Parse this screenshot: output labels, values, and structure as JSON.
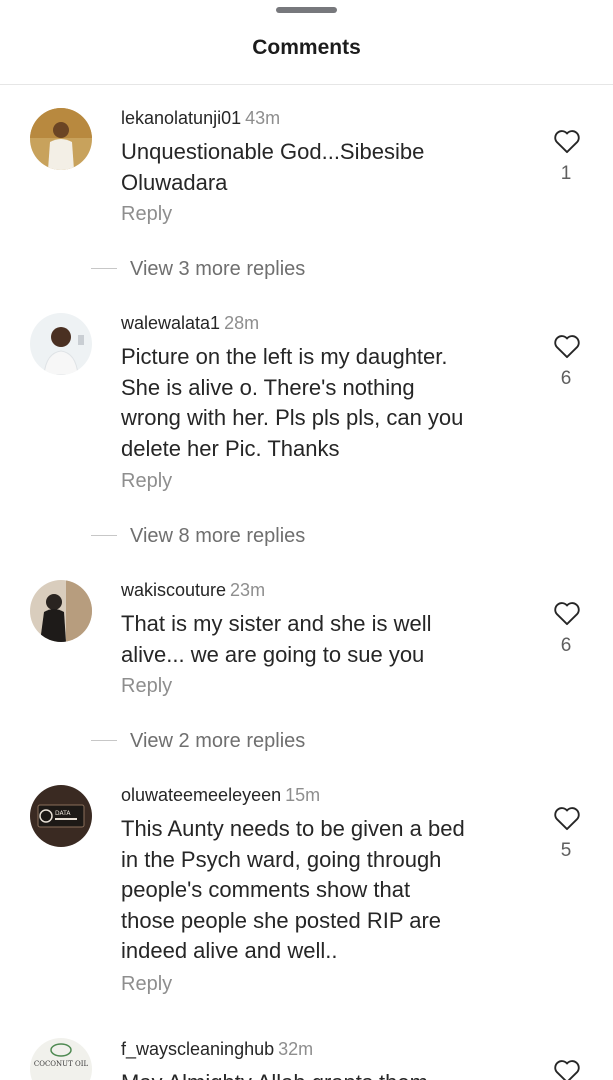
{
  "header": {
    "title": "Comments"
  },
  "comments": [
    {
      "username": "lekanolatunji01",
      "time": "43m",
      "lines": [
        "Unquestionable God...Sibesibe",
        "Oluwadara"
      ],
      "reply_label": "Reply",
      "likes": "1",
      "more_replies": "View 3 more replies"
    },
    {
      "username": "walewalata1",
      "time": "28m",
      "lines": [
        "Picture on the left is my daughter.",
        "She is alive o. There's nothing",
        "wrong with her. Pls pls pls, can you",
        "delete her Pic. Thanks"
      ],
      "reply_label": "Reply",
      "likes": "6",
      "more_replies": "View 8 more replies"
    },
    {
      "username": "wakiscouture",
      "time": "23m",
      "lines": [
        "That is my sister and she is well",
        "alive... we are going to sue you"
      ],
      "reply_label": "Reply",
      "likes": "6",
      "more_replies": "View 2 more replies"
    },
    {
      "username": "oluwateemeeleyeen",
      "time": "15m",
      "lines": [
        "This Aunty needs to be given a bed",
        "in the Psych ward, going through",
        "people's comments show that",
        "those people she posted RIP are",
        "indeed alive and well.."
      ],
      "reply_label": "Reply",
      "likes": "5"
    },
    {
      "username": "f_wayscleaninghub",
      "time": "32m",
      "lines": [
        "May Almighty Allah grants them"
      ]
    }
  ],
  "avatar_badges": {
    "d": "DATA",
    "e": "COCONUT OIL"
  },
  "colors": {
    "text": "#262626",
    "secondary": "#8e8e8e",
    "heart": "#262626"
  }
}
